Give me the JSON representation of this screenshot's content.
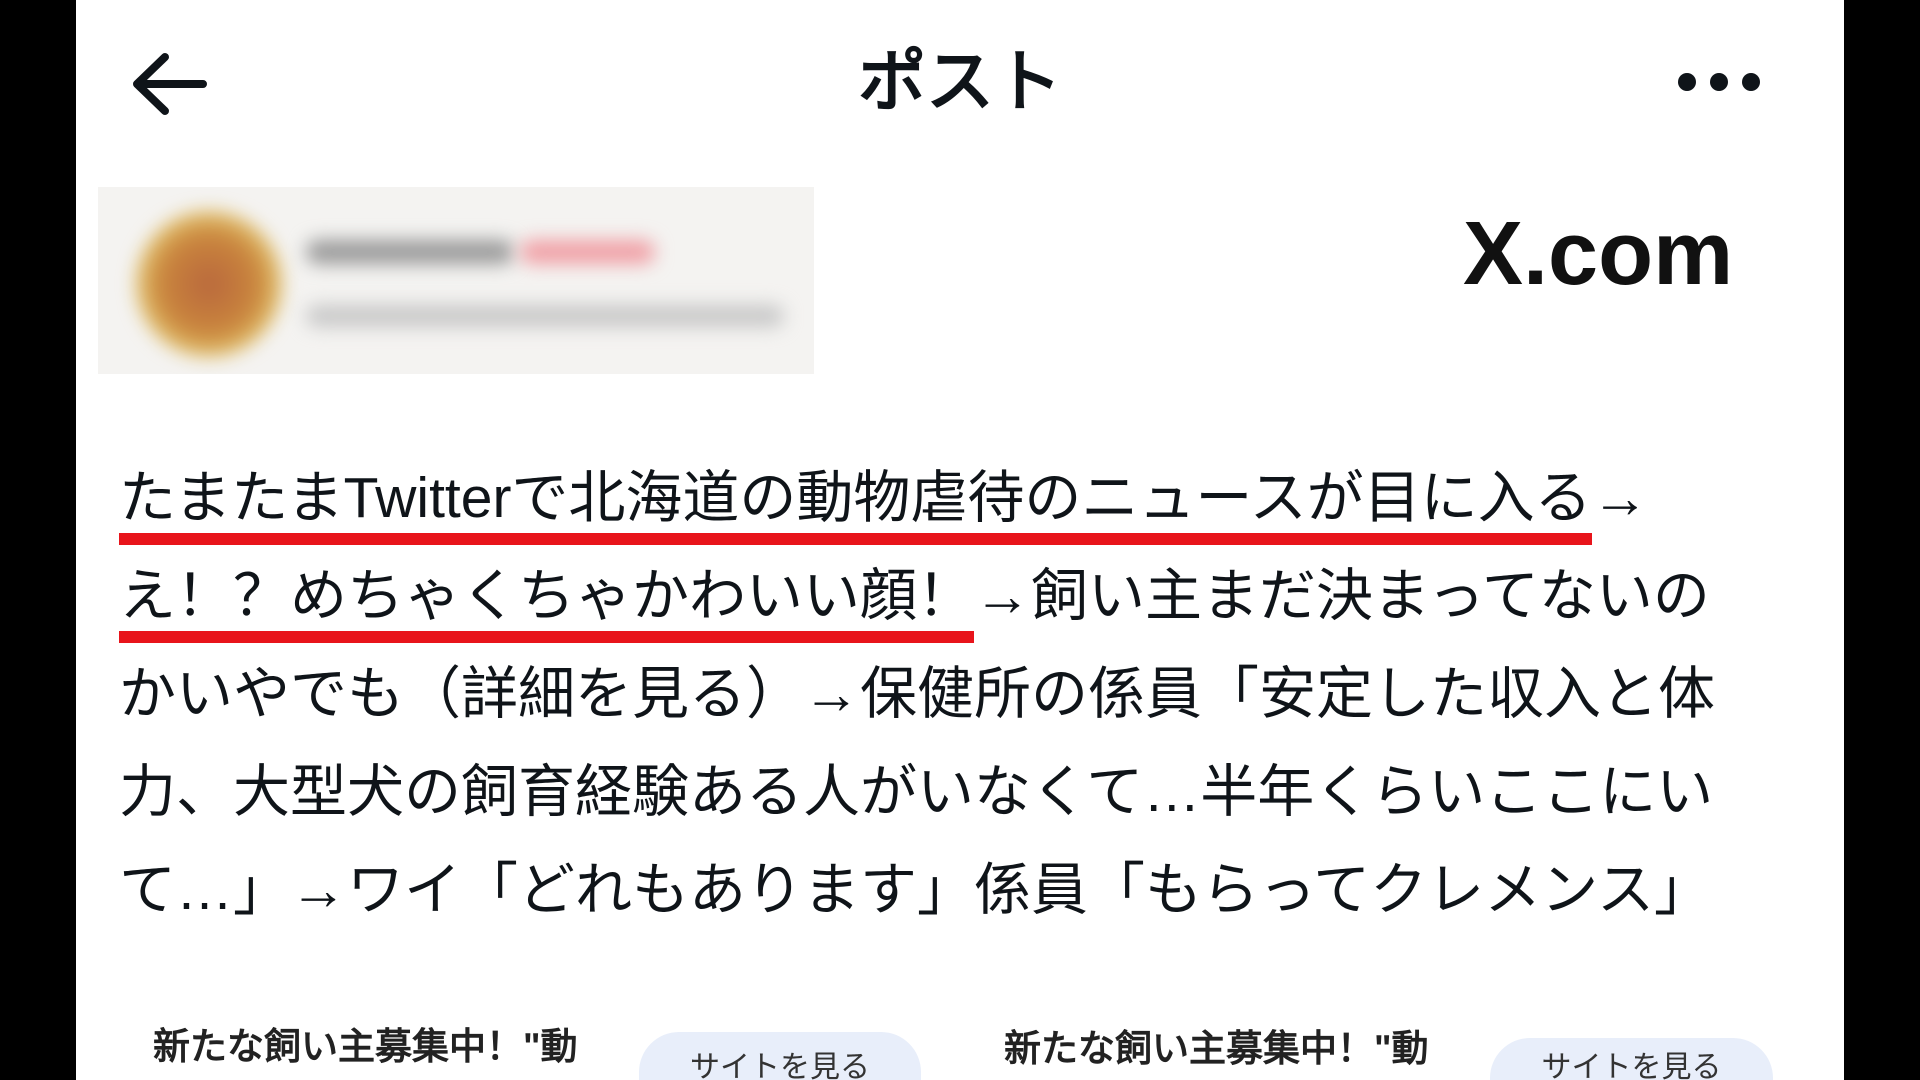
{
  "header": {
    "title": "ポスト",
    "back_icon": "arrow-left-icon",
    "more_icon": "more-horizontal-icon"
  },
  "watermark": "X.com",
  "post": {
    "lines": [
      {
        "highlight": "たまたまTwitterで北海道の動物虐待のニュースが目に入る",
        "text": "→"
      },
      {
        "highlight": "え！？めちゃくちゃかわいい顔！",
        "text": "→飼い主まだ決まってないの"
      },
      {
        "text": "かいやでも（詳細を見る）→保健所の係員「安定した収入と体"
      },
      {
        "text": "力、大型犬の飼育経験ある人がいなくて…半年くらいここにい"
      },
      {
        "text": "て…」→ワイ「どれもあります」係員「もらってクレメンス」"
      }
    ]
  },
  "ads": [
    {
      "text": "新たな飼い主募集中！\"動",
      "button": "サイトを見る"
    },
    {
      "text": "新たな飼い主募集中！\"動",
      "button": "サイトを見る"
    }
  ],
  "colors": {
    "text": "#0f1419",
    "highlight_underline": "#e8141b",
    "ad_button_bg": "#e8eefa"
  }
}
